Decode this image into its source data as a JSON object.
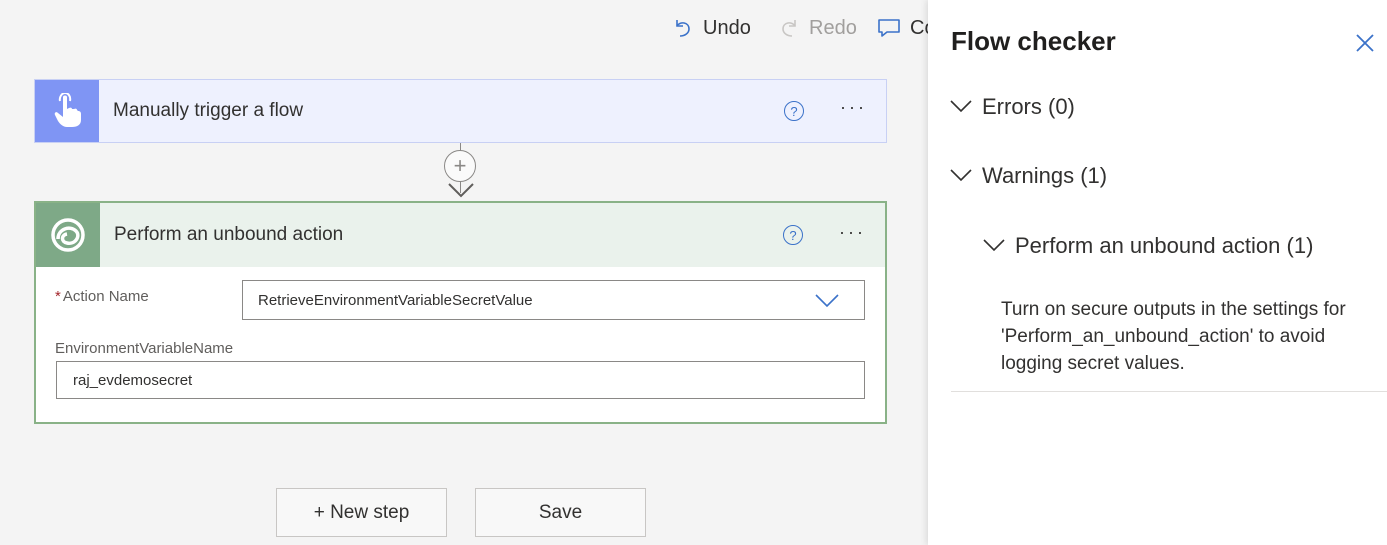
{
  "toolbar": {
    "undo_label": "Undo",
    "redo_label": "Redo",
    "comments_label": "Co"
  },
  "trigger": {
    "title": "Manually trigger a flow",
    "icon": "touch-hand-icon",
    "color": "#7f95f4"
  },
  "connector": {
    "icon": "plus-icon"
  },
  "action": {
    "title": "Perform an unbound action",
    "icon": "dataverse-icon",
    "color": "#7ea987",
    "fields": [
      {
        "label": "Action Name",
        "required": "*",
        "value": "RetrieveEnvironmentVariableSecretValue"
      },
      {
        "label": "EnvironmentVariableName",
        "value": "raj_evdemosecret"
      }
    ]
  },
  "buttons": {
    "new_step": "+ New step",
    "save": "Save"
  },
  "flow_checker": {
    "title": "Flow checker",
    "errors_label": "Errors (0)",
    "warnings_label": "Warnings (1)",
    "warning_group_label": "Perform an unbound action (1)",
    "warning_message": "Turn on secure outputs in the settings for 'Perform_an_unbound_action' to avoid logging secret values."
  },
  "colors": {
    "accent": "#3b72c9",
    "action_border": "#89b287",
    "required": "#a4262c"
  }
}
